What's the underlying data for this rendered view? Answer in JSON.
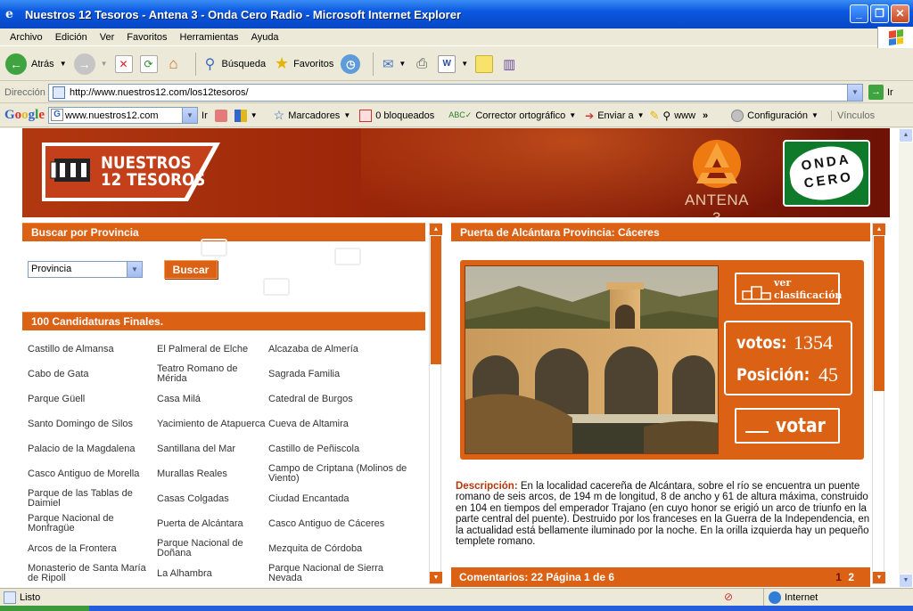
{
  "window": {
    "title": "Nuestros 12 Tesoros - Antena 3 - Onda Cero Radio - Microsoft Internet Explorer",
    "icon": "ie-icon"
  },
  "menu": [
    "Archivo",
    "Edición",
    "Ver",
    "Favoritos",
    "Herramientas",
    "Ayuda"
  ],
  "toolbar": {
    "back_label": "Atrás",
    "search_label": "Búsqueda",
    "favorites_label": "Favoritos"
  },
  "address": {
    "label": "Dirección",
    "url": "http://www.nuestros12.com/los12tesoros/",
    "go_label": "Ir"
  },
  "google_bar": {
    "logo": "Google",
    "search_value": "www.nuestros12.com",
    "go_label": "Ir",
    "bookmarks_label": "Marcadores",
    "blocked_label": "0 bloqueados",
    "spell_label": "Corrector ortográfico",
    "send_label": "Enviar a",
    "www_label": "www",
    "config_label": "Configuración",
    "links_label": "Vínculos"
  },
  "site": {
    "logo_text_line1": "NUESTROS",
    "logo_text_line2": "12 TESOROS",
    "antena_label": "ANTENA 3",
    "onda_line1": "ONDA",
    "onda_line2": "CERO",
    "accent": "#DB6115",
    "header_dark": "#8A1E08"
  },
  "left": {
    "search_title": "Buscar por Provincia",
    "province_value": "Provincia",
    "search_button": "Buscar",
    "candidates_title": "100 Candidaturas Finales.",
    "candidates": [
      [
        "Castillo de Almansa",
        "El Palmeral de Elche",
        "Alcazaba de Almería"
      ],
      [
        "Cabo de Gata",
        "Teatro Romano de Mérida",
        "Sagrada Familia"
      ],
      [
        "Parque Güell",
        "Casa Milá",
        "Catedral de Burgos"
      ],
      [
        "Santo Domingo de Silos",
        "Yacimiento de Atapuerca",
        "Cueva de Altamira"
      ],
      [
        "Palacio de la Magdalena",
        "Santillana del Mar",
        "Castillo de Peñiscola"
      ],
      [
        "Casco Antiguo de Morella",
        "Murallas Reales",
        "Campo de Criptana (Molinos de Viento)"
      ],
      [
        "Parque de las Tablas de Daimiel",
        "Casas Colgadas",
        "Ciudad Encantada"
      ],
      [
        "Parque Nacional de Monfragüe",
        "Puerta de Alcántara",
        "Casco Antiguo de Cáceres"
      ],
      [
        "Arcos de la Frontera",
        "Parque Nacional de Doñana",
        "Mezquita de Córdoba"
      ],
      [
        "Monasterio de Santa María de Ripoll",
        "La Alhambra",
        "Parque Nacional de Sierra Nevada"
      ]
    ]
  },
  "right": {
    "title": "Puerta de Alcántara  Provincia: Cáceres",
    "ver_label_1": "ver",
    "ver_label_2": "clasificación",
    "votos_label": "votos:",
    "votos_value": "1354",
    "posicion_label": "Posición:",
    "posicion_value": "45",
    "votar_label": "votar",
    "desc_label": "Descripción:",
    "desc_text": " En la localidad cacereña de Alcántara, sobre el río se encuentra un puente romano de seis arcos, de 194 m de longitud, 8 de ancho y 61 de altura máxima, construido en 104 en tiempos del emperador Trajano (en cuyo honor se erigió un arco de triunfo en la parte central del puente). Destruido por los franceses en la Guerra de la Independencia, en la actualidad está bellamente iluminado por la noche. En la orilla izquierda hay un pequeño templete romano.",
    "comments_label": "Comentarios: 22   Página 1 de 6",
    "page_1": "1",
    "page_2": "2"
  },
  "status": {
    "text": "Listo",
    "zone": "Internet"
  }
}
